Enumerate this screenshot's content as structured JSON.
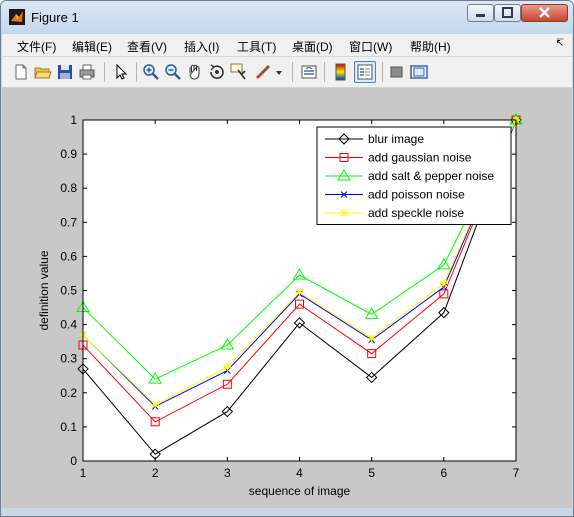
{
  "window": {
    "title": "Figure 1"
  },
  "menu": [
    "文件(F)",
    "编辑(E)",
    "查看(V)",
    "插入(I)",
    "工具(T)",
    "桌面(D)",
    "窗口(W)",
    "帮助(H)"
  ],
  "toolbar": [
    "new-figure-icon",
    "open-file-icon",
    "save-icon",
    "print-icon",
    "pointer-icon",
    "zoom-in-icon",
    "zoom-out-icon",
    "pan-icon",
    "rotate-3d-icon",
    "data-cursor-icon",
    "brush-icon",
    "brush-dropdown-icon",
    "link-plot-icon",
    "colorbar-icon",
    "legend-icon",
    "hide-plot-tools-icon",
    "show-plot-tools-icon"
  ],
  "chart_data": {
    "type": "line",
    "x": [
      1,
      2,
      3,
      4,
      5,
      6,
      7
    ],
    "xlim": [
      1,
      7
    ],
    "ylim": [
      0,
      1
    ],
    "xticks": [
      "1",
      "2",
      "3",
      "4",
      "5",
      "6",
      "7"
    ],
    "yticks": [
      "0",
      "0.1",
      "0.2",
      "0.3",
      "0.4",
      "0.5",
      "0.6",
      "0.7",
      "0.8",
      "0.9",
      "1"
    ],
    "xlabel": "sequence of image",
    "ylabel": "definition value",
    "legend_position": "top-right",
    "grid": false,
    "series": [
      {
        "name": "blur image",
        "color": "#000000",
        "marker": "diamond",
        "values": [
          0.27,
          0.02,
          0.145,
          0.405,
          0.245,
          0.435,
          1.0
        ]
      },
      {
        "name": "add gaussian noise",
        "color": "#ff0000",
        "marker": "square",
        "values": [
          0.34,
          0.115,
          0.225,
          0.46,
          0.315,
          0.49,
          1.0
        ]
      },
      {
        "name": "add salt & pepper noise",
        "color": "#00ff00",
        "marker": "triangle",
        "values": [
          0.45,
          0.24,
          0.34,
          0.545,
          0.43,
          0.575,
          1.0
        ]
      },
      {
        "name": "add poisson noise",
        "color": "#0000ff",
        "marker": "x",
        "values": [
          0.37,
          0.16,
          0.265,
          0.49,
          0.355,
          0.51,
          1.0
        ]
      },
      {
        "name": "add speckle noise",
        "color": "#ffff00",
        "marker": "star",
        "values": [
          0.37,
          0.165,
          0.275,
          0.495,
          0.36,
          0.52,
          1.0
        ]
      }
    ]
  }
}
